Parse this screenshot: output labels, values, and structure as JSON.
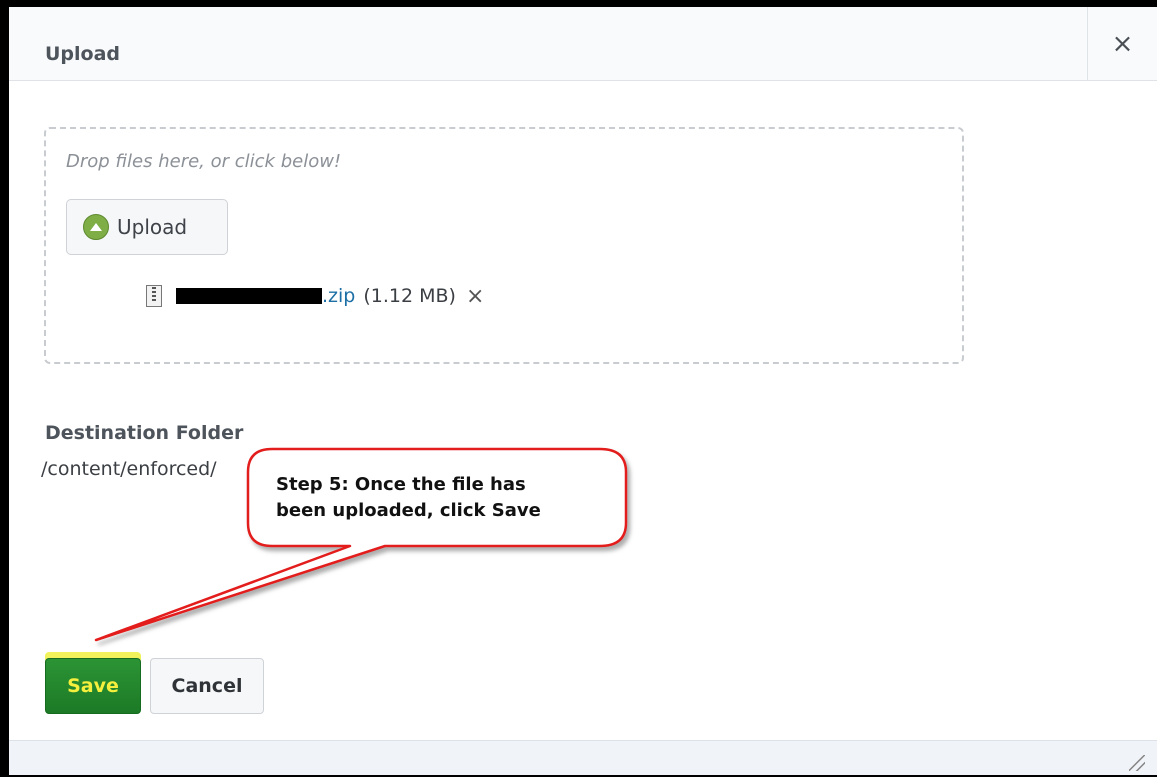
{
  "dialog": {
    "title": "Upload",
    "close_glyph": "×",
    "dropzone": {
      "hint": "Drop files here, or click below!",
      "upload_button": "Upload",
      "file": {
        "icon": "zip-file-icon",
        "extension": ".zip",
        "size": "(1.12 MB)",
        "remove_glyph": "×"
      }
    },
    "destination": {
      "label": "Destination Folder",
      "path": "/content/enforced/"
    },
    "buttons": {
      "save": "Save",
      "cancel": "Cancel"
    }
  },
  "annotation": {
    "text_line1": "Step 5: Once the file has",
    "text_line2": "been uploaded, click Save",
    "color": "#e31b1b"
  },
  "colors": {
    "save_bg": "#1f8a2b",
    "save_text": "#f5ef3d",
    "link": "#1d6fa5"
  }
}
